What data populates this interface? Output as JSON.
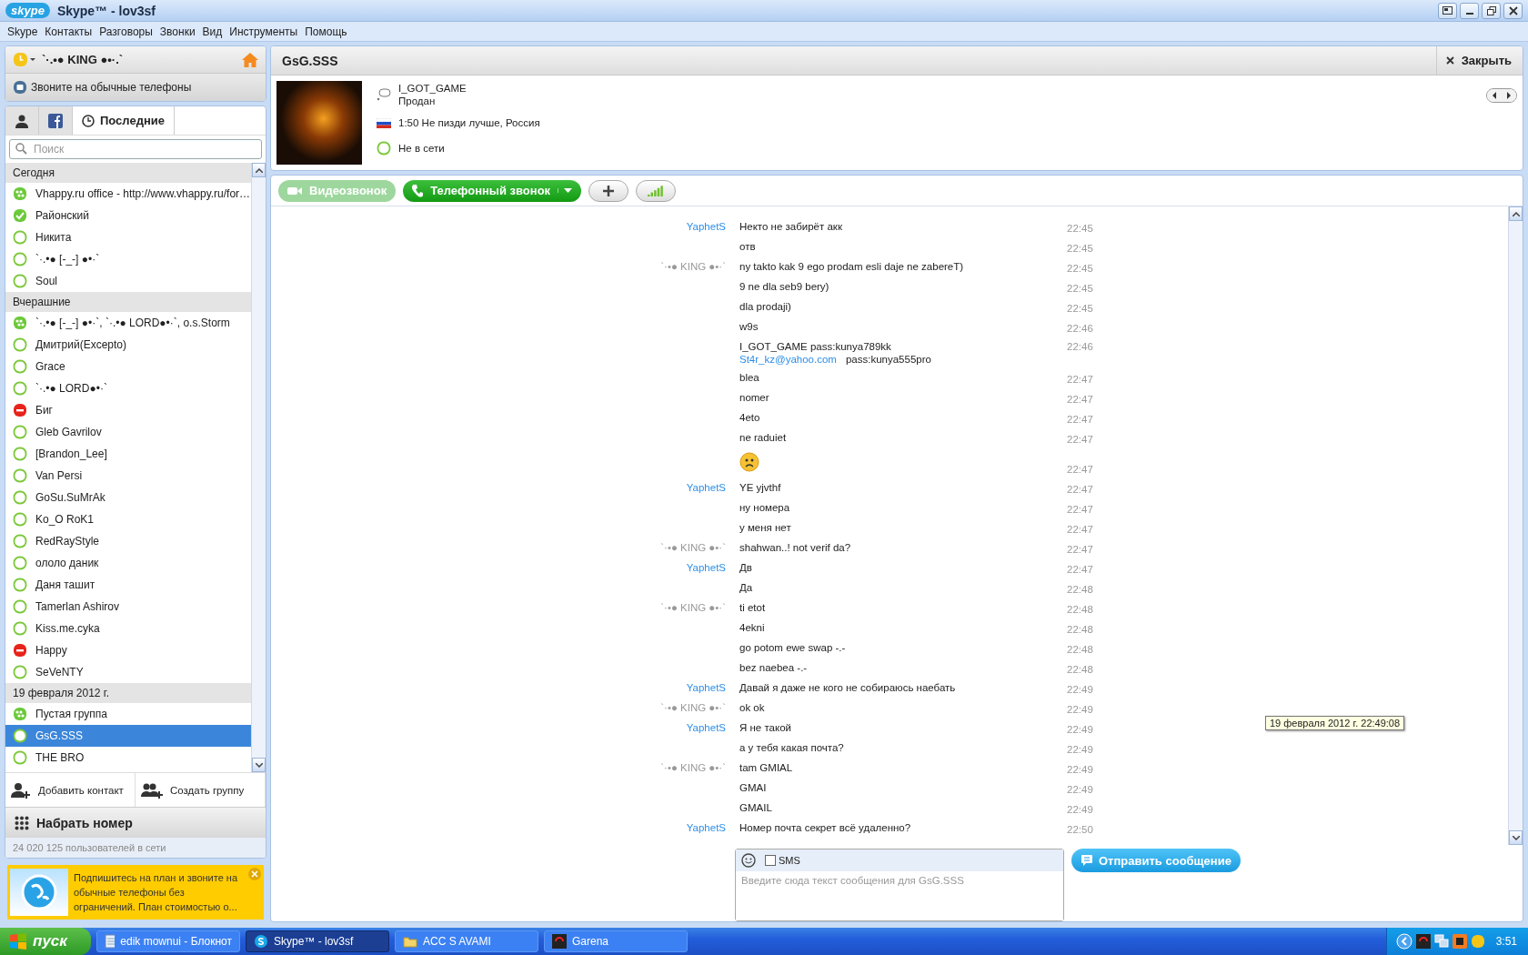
{
  "window": {
    "logo": "skype",
    "title": "Skype™ - lov3sf"
  },
  "menu": [
    "Skype",
    "Контакты",
    "Разговоры",
    "Звонки",
    "Вид",
    "Инструменты",
    "Помощь"
  ],
  "profile": {
    "name": "`·.•● KING ●•·.`",
    "call_phones": "Звоните на обычные телефоны"
  },
  "tabs": [
    {
      "kind": "contacts",
      "selected": false
    },
    {
      "kind": "facebook",
      "selected": false
    },
    {
      "kind": "recent",
      "label": "Последние",
      "selected": true
    }
  ],
  "search": {
    "placeholder": "Поиск"
  },
  "contact_groups": [
    {
      "title": "Сегодня",
      "contacts": [
        {
          "name": "Vhappy.ru office - http://www.vhappy.ru/for…",
          "kind": "group",
          "selected": false
        },
        {
          "name": "Районский",
          "kind": "online",
          "selected": false
        },
        {
          "name": "Никита",
          "kind": "offline",
          "selected": false
        },
        {
          "name": "`·.•● [-_-] ●•·`",
          "kind": "offline",
          "selected": false
        },
        {
          "name": "Soul",
          "kind": "offline",
          "selected": false
        }
      ]
    },
    {
      "title": "Вчерашние",
      "contacts": [
        {
          "name": "`·.•● [-_-] ●•·`, `·.•● LORD●•·`, o.s.Storm",
          "kind": "group",
          "selected": false
        },
        {
          "name": "Дмитрий(Excepto)",
          "kind": "offline",
          "selected": false
        },
        {
          "name": "Grace",
          "kind": "offline",
          "selected": false
        },
        {
          "name": "`·.•● LORD●•·`",
          "kind": "offline",
          "selected": false
        },
        {
          "name": "Биг",
          "kind": "dnd",
          "selected": false
        },
        {
          "name": "Gleb Gavrilov",
          "kind": "offline",
          "selected": false
        },
        {
          "name": "[Brandon_Lee]",
          "kind": "offline",
          "selected": false
        },
        {
          "name": "Van Persi",
          "kind": "offline",
          "selected": false
        },
        {
          "name": "GoSu.SuMrAk",
          "kind": "offline",
          "selected": false
        },
        {
          "name": "Ko_O RoK1",
          "kind": "offline",
          "selected": false
        },
        {
          "name": "RedRayStyle",
          "kind": "offline",
          "selected": false
        },
        {
          "name": "ололо даник",
          "kind": "offline",
          "selected": false
        },
        {
          "name": "Даня ташит",
          "kind": "offline",
          "selected": false
        },
        {
          "name": "Tamerlan Ashirov",
          "kind": "offline",
          "selected": false
        },
        {
          "name": "Kiss.me.cyka",
          "kind": "offline",
          "selected": false
        },
        {
          "name": "Happy",
          "kind": "dnd",
          "selected": false
        },
        {
          "name": "SeVeNTY",
          "kind": "offline",
          "selected": false
        }
      ]
    },
    {
      "title": "19 февраля 2012 г.",
      "contacts": [
        {
          "name": "Пустая группа",
          "kind": "group",
          "selected": false
        },
        {
          "name": "GsG.SSS",
          "kind": "offline",
          "selected": true
        },
        {
          "name": "THE BRO",
          "kind": "offline",
          "selected": false
        }
      ]
    }
  ],
  "add_contact": "Добавить контакт",
  "create_group": "Создать группу",
  "dial": "Набрать номер",
  "online_count": "24 020 125 пользователей в сети",
  "promo": "Подпишитесь на план и звоните на обычные телефоны без ограничений. План стоимостью о...",
  "conversation": {
    "title": "GsG.SSS",
    "close": "Закрыть",
    "mood": "I_GOT_GAME",
    "mood_note": "Продан",
    "location": "1:50 Не пизди лучше, Россия",
    "status": "Не в сети"
  },
  "call_buttons": {
    "video": {
      "label": "Видеозвонок",
      "disabled": true
    },
    "phone": {
      "label": "Телефонный звонок",
      "disabled": false
    }
  },
  "messages": [
    {
      "sender": "YaphetS",
      "self": false,
      "kind": "text",
      "text": "Некто не забирёт акк",
      "time": "22:45"
    },
    {
      "kind": "text",
      "text": "отв",
      "time": "22:45"
    },
    {
      "sender": "`·•● KING ●•·`",
      "self": true,
      "kind": "text",
      "text": "ny takto kak 9 ego prodam esli daje ne zabereT)",
      "time": "22:45"
    },
    {
      "kind": "text",
      "text": "9 ne dla seb9 bery)",
      "time": "22:45"
    },
    {
      "kind": "text",
      "text": "dla prodaji)",
      "time": "22:45"
    },
    {
      "kind": "text",
      "text": "w9s",
      "time": "22:46"
    },
    {
      "kind": "text",
      "text": "I_GOT_GAME   pass:kunya789kk",
      "link": "St4r_kz@yahoo.com",
      "after_link": "pass:kunya555pro",
      "time": "22:46"
    },
    {
      "kind": "text",
      "text": "blea",
      "time": "22:47"
    },
    {
      "kind": "text",
      "text": "nomer",
      "time": "22:47"
    },
    {
      "kind": "text",
      "text": "4eto",
      "time": "22:47"
    },
    {
      "kind": "text",
      "text": "ne raduiet",
      "time": "22:47"
    },
    {
      "kind": "emoticon",
      "time": "22:47"
    },
    {
      "sender": "YaphetS",
      "self": false,
      "kind": "text",
      "text": "YE yjvthf",
      "time": "22:47"
    },
    {
      "kind": "text",
      "text": "ну номера",
      "time": "22:47"
    },
    {
      "kind": "text",
      "text": "у меня нет",
      "time": "22:47"
    },
    {
      "sender": "`·•● KING ●•·`",
      "self": true,
      "kind": "text",
      "text": "shahwan..! not verif da?",
      "time": "22:47"
    },
    {
      "sender": "YaphetS",
      "self": false,
      "kind": "text",
      "text": "Дв",
      "time": "22:47"
    },
    {
      "kind": "text",
      "text": "Да",
      "time": "22:48"
    },
    {
      "sender": "`·•● KING ●•·`",
      "self": true,
      "kind": "text",
      "text": "ti etot",
      "time": "22:48"
    },
    {
      "kind": "text",
      "text": "4ekni",
      "time": "22:48"
    },
    {
      "kind": "text",
      "text": "go potom ewe swap -.-",
      "time": "22:48"
    },
    {
      "kind": "text",
      "text": "bez naebea -.-",
      "time": "22:48"
    },
    {
      "sender": "YaphetS",
      "self": false,
      "kind": "text",
      "text": "Давай я даже не кого не собираюсь наебать",
      "time": "22:49"
    },
    {
      "sender": "`·•● KING ●•·`",
      "self": true,
      "kind": "text",
      "text": "ok ok",
      "time": "22:49"
    },
    {
      "sender": "YaphetS",
      "self": false,
      "kind": "text",
      "text": "Я не такой",
      "time": "22:49"
    },
    {
      "kind": "text",
      "text": "а у тебя какая почта?",
      "time": "22:49"
    },
    {
      "sender": "`·•● KING ●•·`",
      "self": true,
      "kind": "text",
      "text": "tam GMIAL",
      "time": "22:49"
    },
    {
      "kind": "text",
      "text": "GMAI",
      "time": "22:49"
    },
    {
      "kind": "text",
      "text": "GMAIL",
      "time": "22:49"
    },
    {
      "sender": "YaphetS",
      "self": false,
      "kind": "text",
      "text": "Номер почта секрет всё удаленно?",
      "time": "22:50"
    }
  ],
  "tooltip": "19 февраля 2012 г. 22:49:08",
  "composer": {
    "sms_label": "SMS",
    "sms_checked": false,
    "placeholder": "Введите сюда текст сообщения для GsG.SSS",
    "send": "Отправить сообщение"
  },
  "taskbar": {
    "start": "пуск",
    "tasks": [
      {
        "label": "edik mownui - Блокнот",
        "kind": "notepad",
        "selected": false
      },
      {
        "label": "Skype™ - lov3sf",
        "kind": "skype",
        "selected": true
      },
      {
        "label": "ACC S AVAMI",
        "kind": "folder",
        "selected": false
      },
      {
        "label": "Garena",
        "kind": "garena",
        "selected": false
      }
    ],
    "clock": "3:51"
  }
}
